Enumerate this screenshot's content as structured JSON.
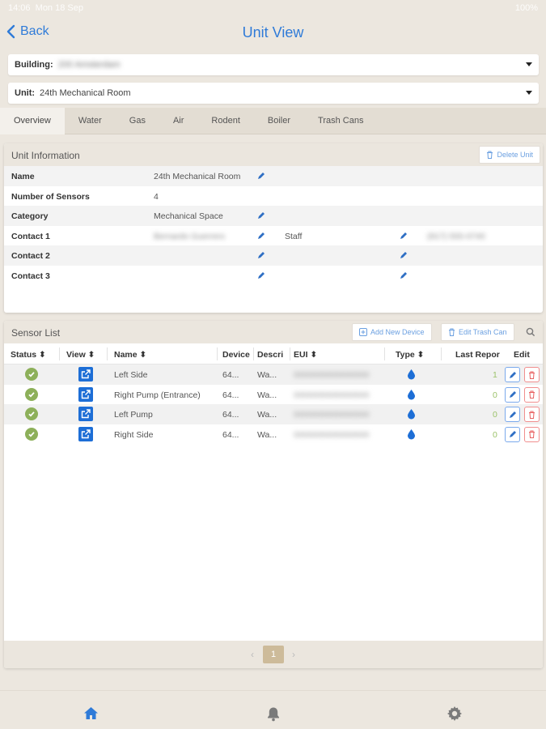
{
  "status_bar": {
    "time": "14:06",
    "date": "Mon 18 Sep",
    "battery": "100%"
  },
  "nav": {
    "back_label": "Back",
    "title": "Unit View"
  },
  "building": {
    "label": "Building:",
    "value": "200 Amsterdam"
  },
  "unit": {
    "label": "Unit:",
    "value": "24th Mechanical Room"
  },
  "tabs": [
    "Overview",
    "Water",
    "Gas",
    "Air",
    "Rodent",
    "Boiler",
    "Trash Cans"
  ],
  "unit_info": {
    "title": "Unit Information",
    "delete_label": "Delete Unit",
    "rows": [
      {
        "key": "Name",
        "value": "24th Mechanical Room"
      },
      {
        "key": "Number of Sensors",
        "value": "4"
      },
      {
        "key": "Category",
        "value": "Mechanical Space"
      },
      {
        "key": "Contact 1",
        "value": "Bernardo Guerrero",
        "role": "Staff",
        "phone": "(917) 555-0740"
      },
      {
        "key": "Contact 2",
        "value": ""
      },
      {
        "key": "Contact 3",
        "value": ""
      }
    ]
  },
  "sensor_list": {
    "title": "Sensor List",
    "add_label": "Add New Device",
    "edit_trash_label": "Edit Trash Can",
    "columns": [
      "Status",
      "View",
      "Name",
      "Device",
      "Descri",
      "EUI",
      "Type",
      "Last Repor",
      "Edit"
    ],
    "rows": [
      {
        "name": "Left Side",
        "device": "64...",
        "desc": "Wa...",
        "eui": "0000000000000000",
        "last": "1"
      },
      {
        "name": "Right Pump (Entrance)",
        "device": "64...",
        "desc": "Wa...",
        "eui": "0000000000000000",
        "last": "0"
      },
      {
        "name": "Left Pump",
        "device": "64...",
        "desc": "Wa...",
        "eui": "0000000000000000",
        "last": "0"
      },
      {
        "name": "Right Side",
        "device": "64...",
        "desc": "Wa...",
        "eui": "0000000000000000",
        "last": "0"
      }
    ]
  },
  "pagination": {
    "prev": "‹",
    "current": "1",
    "next": "›"
  },
  "colors": {
    "accent": "#2f7bd8",
    "status_ok": "#8db05a",
    "danger": "#f08e8e",
    "page_active": "#cdbb9a"
  }
}
